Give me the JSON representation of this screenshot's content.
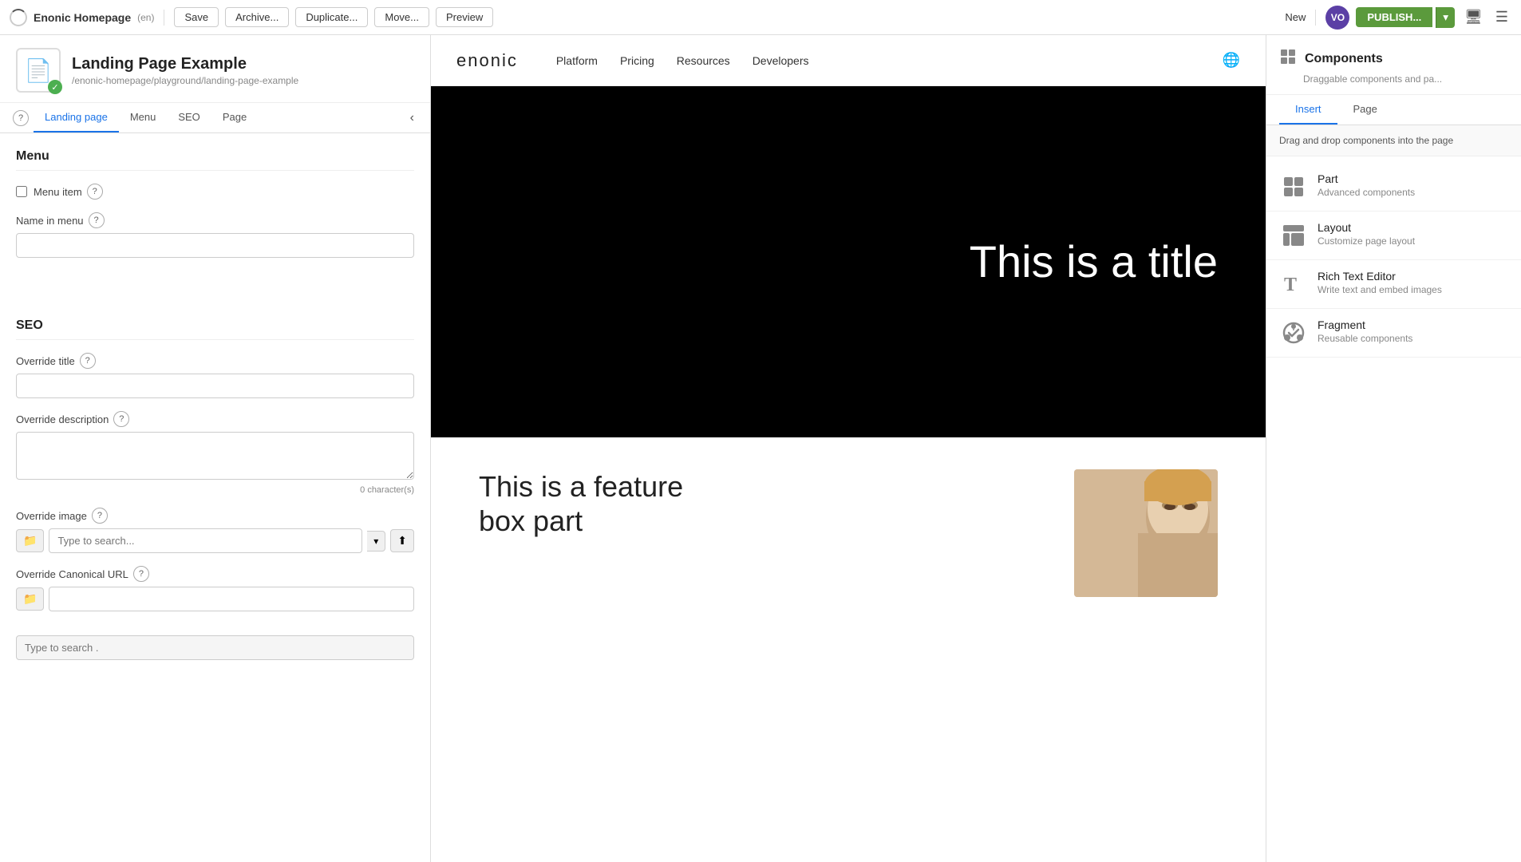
{
  "toolbar": {
    "app_name": "Enonic Homepage",
    "app_locale": "(en)",
    "save_label": "Save",
    "archive_label": "Archive...",
    "duplicate_label": "Duplicate...",
    "move_label": "Move...",
    "preview_label": "Preview",
    "new_label": "New",
    "publish_label": "PUBLISH...",
    "avatar_initials": "VO"
  },
  "content": {
    "title": "Landing Page Example",
    "path": "/enonic-homepage/playground/landing-page-example"
  },
  "tabs": {
    "items": [
      {
        "label": "Landing page",
        "active": true
      },
      {
        "label": "Menu",
        "active": false
      },
      {
        "label": "SEO",
        "active": false
      },
      {
        "label": "Page",
        "active": false
      }
    ]
  },
  "form": {
    "menu_section": "Menu",
    "menu_item_label": "Menu item",
    "name_in_menu_label": "Name in menu",
    "seo_section": "SEO",
    "override_title_label": "Override title",
    "override_description_label": "Override description",
    "char_count": "0 character(s)",
    "override_image_label": "Override image",
    "override_canonical_label": "Override Canonical URL",
    "search_placeholder": "Type to search...",
    "type_to_search": "Type to search ."
  },
  "preview": {
    "logo": "enonic",
    "nav_links": [
      {
        "label": "Platform"
      },
      {
        "label": "Pricing"
      },
      {
        "label": "Resources"
      },
      {
        "label": "Developers"
      }
    ],
    "hero_title": "This is a title",
    "feature_title": "This is a feature\nbox part"
  },
  "right_panel": {
    "title": "Components",
    "subtitle": "Draggable components and pa...",
    "tabs": [
      {
        "label": "Insert",
        "active": true
      },
      {
        "label": "Page",
        "active": false
      }
    ],
    "drag_info": "Drag and drop components into the page",
    "components": [
      {
        "name": "Part",
        "description": "Advanced components",
        "icon": "part"
      },
      {
        "name": "Layout",
        "description": "Customize page layout",
        "icon": "layout"
      },
      {
        "name": "Rich Text Editor",
        "description": "Write text and embed images",
        "icon": "richtext"
      },
      {
        "name": "Fragment",
        "description": "Reusable components",
        "icon": "fragment"
      }
    ]
  }
}
